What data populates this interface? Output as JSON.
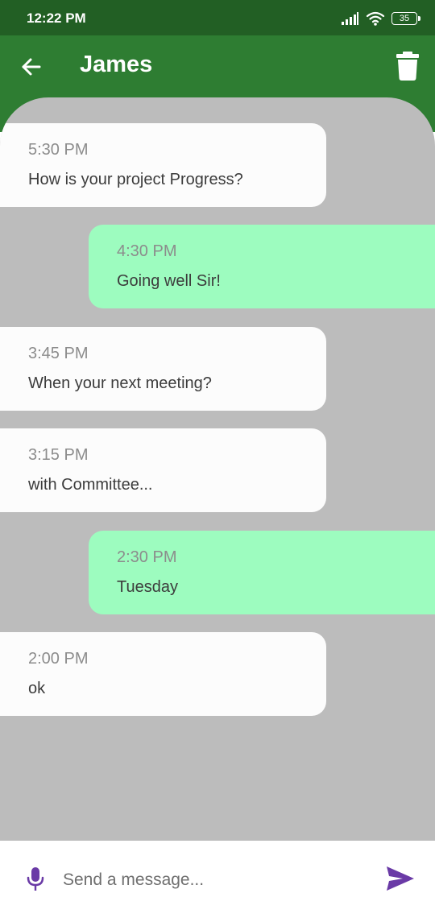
{
  "status_bar": {
    "time": "12:22 PM",
    "battery": "35",
    "icons": [
      "signal-icon",
      "wifi-icon",
      "battery-icon"
    ]
  },
  "app_bar": {
    "title": "James",
    "back_icon": "arrow-left-icon",
    "delete_icon": "trash-icon"
  },
  "messages": [
    {
      "direction": "incoming",
      "time": "5:30 PM",
      "text": "How is your project Progress?"
    },
    {
      "direction": "outgoing",
      "time": "4:30 PM",
      "text": "Going well Sir!"
    },
    {
      "direction": "incoming",
      "time": "3:45 PM",
      "text": "When your next meeting?"
    },
    {
      "direction": "incoming",
      "time": "3:15 PM",
      "text": "with Committee..."
    },
    {
      "direction": "outgoing",
      "time": "2:30 PM",
      "text": "Tuesday"
    },
    {
      "direction": "incoming",
      "time": "2:00 PM",
      "text": "ok"
    }
  ],
  "composer": {
    "placeholder": "Send a message...",
    "value": "",
    "mic_icon": "microphone-icon",
    "send_icon": "send-icon"
  },
  "colors": {
    "status_bar": "#225f24",
    "app_bar": "#2e7d32",
    "chat_background": "#bcbcbc",
    "incoming_bubble": "#fcfcfc",
    "outgoing_bubble": "#9dfcbf",
    "accent": "#6a3aa6"
  }
}
